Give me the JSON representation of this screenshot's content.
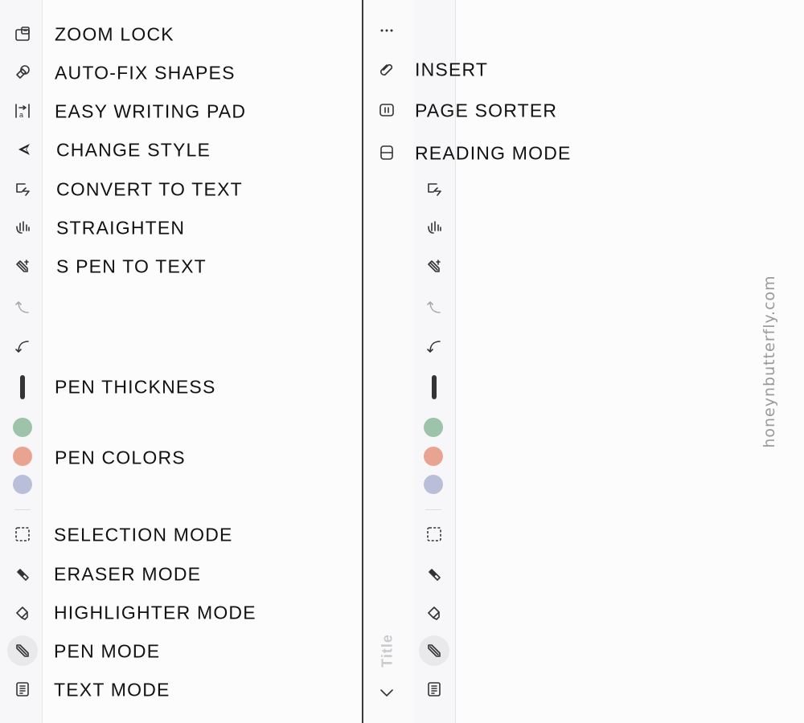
{
  "labels": {
    "zoom_lock": "ZOOM LOCK",
    "auto_fix_shapes": "AUTO-FIX SHAPES",
    "easy_writing_pad": "EASY WRITING PAD",
    "change_style": "CHANGE STYLE",
    "convert_to_text": "CONVERT TO TEXT",
    "straighten": "STRAIGHTEN",
    "s_pen_to_text": "S PEN TO TEXT",
    "pen_thickness": "PEN THICKNESS",
    "pen_colors": "PEN COLORS",
    "selection_mode": "SELECTION MODE",
    "eraser_mode": "ERASER MODE",
    "highlighter_mode": "HIGHLIGHTER MODE",
    "pen_mode": "PEN MODE",
    "text_mode": "TEXT MODE",
    "insert": "INSERT",
    "page_sorter": "PAGE SORTER",
    "reading_mode": "READING MODE"
  },
  "title_vertical": "Title",
  "watermark": "honeynbutterfly.com",
  "pen_colors": [
    "#9dc3ab",
    "#e8a490",
    "#b9bfd9"
  ],
  "icons": {
    "left_toolbar": [
      "zoom-lock-icon",
      "auto-fix-shapes-icon",
      "easy-writing-pad-icon",
      "change-style-icon",
      "convert-to-text-icon",
      "straighten-icon",
      "s-pen-to-text-icon",
      "redo-icon",
      "undo-icon",
      "pen-thickness-icon",
      "pen-color-swatch",
      "selection-icon",
      "eraser-icon",
      "highlighter-icon",
      "pen-icon",
      "text-mode-icon"
    ],
    "right_panel": [
      "more-icon",
      "insert-icon",
      "page-sorter-icon",
      "reading-mode-icon",
      "chevron-down-icon"
    ]
  }
}
